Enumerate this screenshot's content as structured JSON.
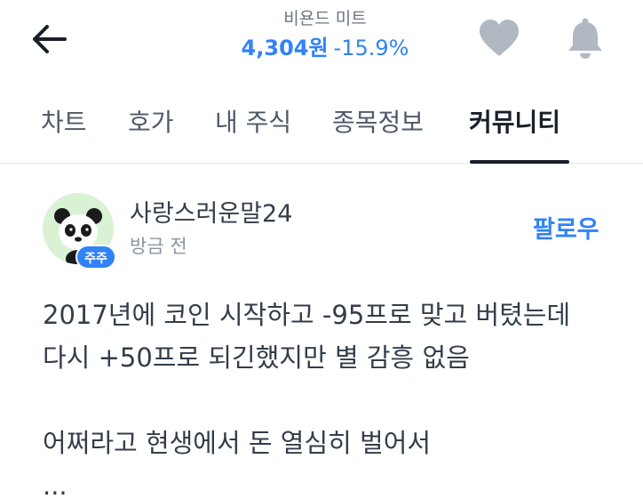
{
  "header": {
    "stock_name": "비욘드 미트",
    "price": "4,304원",
    "change": "-15.9%",
    "icons": {
      "back": "back-arrow-icon",
      "favorite": "heart-icon",
      "notification": "bell-icon"
    }
  },
  "tabs": [
    {
      "label": "차트"
    },
    {
      "label": "호가"
    },
    {
      "label": "내 주식"
    },
    {
      "label": "종목정보"
    },
    {
      "label": "커뮤니티"
    }
  ],
  "active_tab": "커뮤니티",
  "post": {
    "author": "사랑스러운말24",
    "time": "방금 전",
    "badge": "주주",
    "follow_label": "팔로우",
    "lines": [
      "2017년에 코인 시작하고 -95프로 맞고 버텼는데",
      "다시 +50프로 되긴했지만 별 감흥 없음",
      "어쩌라고 현생에서 돈 열심히 벌어서",
      "..."
    ]
  },
  "colors": {
    "accent": "#3182f6",
    "text": "#333d4b",
    "muted": "#8b95a1",
    "icon_gray": "#b0b8c1"
  }
}
